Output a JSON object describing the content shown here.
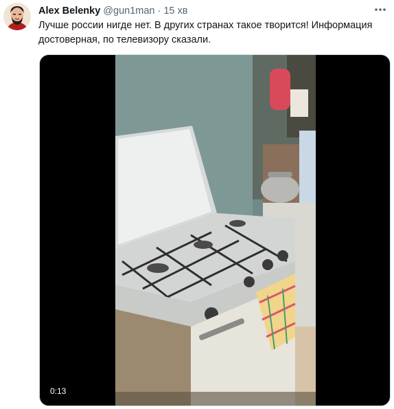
{
  "tweet": {
    "author_name": "Alex Belenky",
    "handle": "@gun1man",
    "separator": "·",
    "time": "15 хв",
    "more_icon": "more-horizontal-icon",
    "text": "Лучше россии нигде нет. В других странах такое творится! Информация достоверная, по телевизору сказали."
  },
  "media": {
    "type": "video",
    "timecode": "0:13"
  },
  "colors": {
    "text_primary": "#0f1419",
    "text_secondary": "#536471",
    "media_background": "#000000"
  }
}
